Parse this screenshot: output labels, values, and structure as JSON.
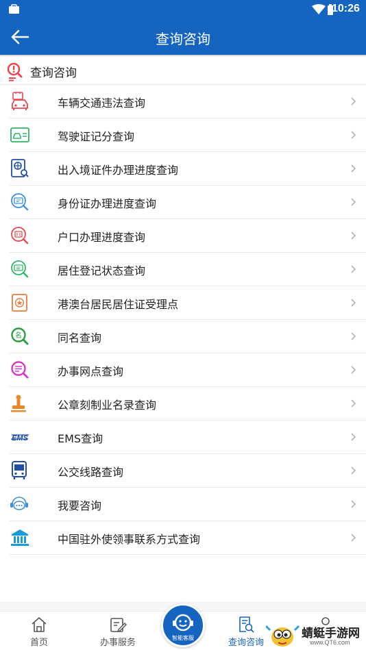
{
  "status_bar": {
    "time": "10:26"
  },
  "app_bar": {
    "title": "查询咨询"
  },
  "section": {
    "title": "查询咨询"
  },
  "items": [
    {
      "label": "车辆交通违法查询",
      "icon": "car-violation-icon",
      "color": "#e9474f"
    },
    {
      "label": "驾驶证记分查询",
      "icon": "driver-license-icon",
      "color": "#2fb567"
    },
    {
      "label": "出入境证件办理进度查询",
      "icon": "passport-search-icon",
      "color": "#1f4fa6"
    },
    {
      "label": "身份证办理进度查询",
      "icon": "id-card-search-icon",
      "color": "#3d8fe0"
    },
    {
      "label": "户口办理进度查询",
      "icon": "household-search-icon",
      "color": "#e9474f"
    },
    {
      "label": "居住登记状态查询",
      "icon": "residence-search-icon",
      "color": "#2fb567"
    },
    {
      "label": "港澳台居民居住证受理点",
      "icon": "hk-macao-taiwan-icon",
      "color": "#e87a3c"
    },
    {
      "label": "同名查询",
      "icon": "same-name-icon",
      "color": "#2a9d3f"
    },
    {
      "label": "办事网点查询",
      "icon": "service-point-icon",
      "color": "#d43cc8"
    },
    {
      "label": "公章刻制业名录查询",
      "icon": "seal-icon",
      "color": "#e8882c"
    },
    {
      "label": "EMS查询",
      "icon": "ems-icon",
      "color": "#1f4fa6"
    },
    {
      "label": "公交线路查询",
      "icon": "bus-icon",
      "color": "#1f4fa6"
    },
    {
      "label": "我要咨询",
      "icon": "chat-icon",
      "color": "#3d8fe0"
    },
    {
      "label": "中国驻外使领事联系方式查询",
      "icon": "embassy-icon",
      "color": "#1a9bd8"
    }
  ],
  "bottom_nav": {
    "home": "首页",
    "services": "办事服务",
    "assistant": "智能客服",
    "query": "查询咨询"
  },
  "watermark": {
    "title": "蜻蜓手游网",
    "url": "www.QT6.com"
  },
  "colors": {
    "primary": "#1565c0",
    "divider": "#e8e8e8"
  }
}
